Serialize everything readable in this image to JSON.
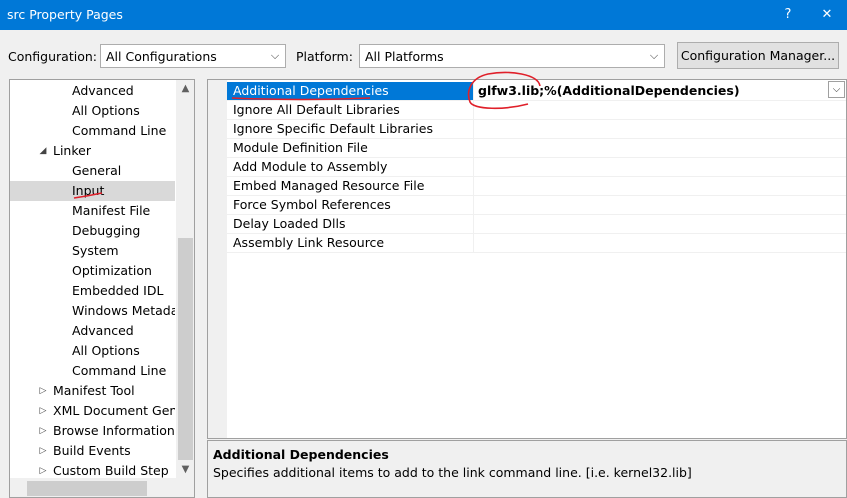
{
  "window": {
    "title": "src Property Pages",
    "help_label": "?",
    "close_label": "✕"
  },
  "toolbar": {
    "configuration_label": "Configuration:",
    "configuration_value": "All Configurations",
    "platform_label": "Platform:",
    "platform_value": "All Platforms",
    "config_manager_label": "Configuration Manager..."
  },
  "tree": {
    "items": [
      {
        "label": "Advanced",
        "expander": ""
      },
      {
        "label": "All Options",
        "expander": ""
      },
      {
        "label": "Command Line",
        "expander": ""
      },
      {
        "label": "Linker",
        "expander": "◢"
      },
      {
        "label": "General",
        "expander": ""
      },
      {
        "label": "Input",
        "expander": ""
      },
      {
        "label": "Manifest File",
        "expander": ""
      },
      {
        "label": "Debugging",
        "expander": ""
      },
      {
        "label": "System",
        "expander": ""
      },
      {
        "label": "Optimization",
        "expander": ""
      },
      {
        "label": "Embedded IDL",
        "expander": ""
      },
      {
        "label": "Windows Metadata",
        "expander": ""
      },
      {
        "label": "Advanced",
        "expander": ""
      },
      {
        "label": "All Options",
        "expander": ""
      },
      {
        "label": "Command Line",
        "expander": ""
      },
      {
        "label": "Manifest Tool",
        "expander": "▷"
      },
      {
        "label": "XML Document Generator",
        "expander": "▷"
      },
      {
        "label": "Browse Information",
        "expander": "▷"
      },
      {
        "label": "Build Events",
        "expander": "▷"
      },
      {
        "label": "Custom Build Step",
        "expander": "▷"
      }
    ],
    "scroll_up": "▲",
    "scroll_down": "▼"
  },
  "grid": {
    "rows": [
      {
        "name": "Additional Dependencies",
        "value": "glfw3.lib;%(AdditionalDependencies)"
      },
      {
        "name": "Ignore All Default Libraries",
        "value": ""
      },
      {
        "name": "Ignore Specific Default Libraries",
        "value": ""
      },
      {
        "name": "Module Definition File",
        "value": ""
      },
      {
        "name": "Add Module to Assembly",
        "value": ""
      },
      {
        "name": "Embed Managed Resource File",
        "value": ""
      },
      {
        "name": "Force Symbol References",
        "value": ""
      },
      {
        "name": "Delay Loaded Dlls",
        "value": ""
      },
      {
        "name": "Assembly Link Resource",
        "value": ""
      }
    ],
    "dropdown_glyph": "⌵"
  },
  "description": {
    "title": "Additional Dependencies",
    "text": "Specifies additional items to add to the link command line. [i.e. kernel32.lib]"
  },
  "colors": {
    "accent": "#0078d7",
    "annotation_red": "#e0202a"
  },
  "icons": {
    "dropdown": "chevron-down-icon",
    "tree_expanded": "triangle-expanded-icon",
    "tree_collapsed": "triangle-collapsed-icon"
  }
}
